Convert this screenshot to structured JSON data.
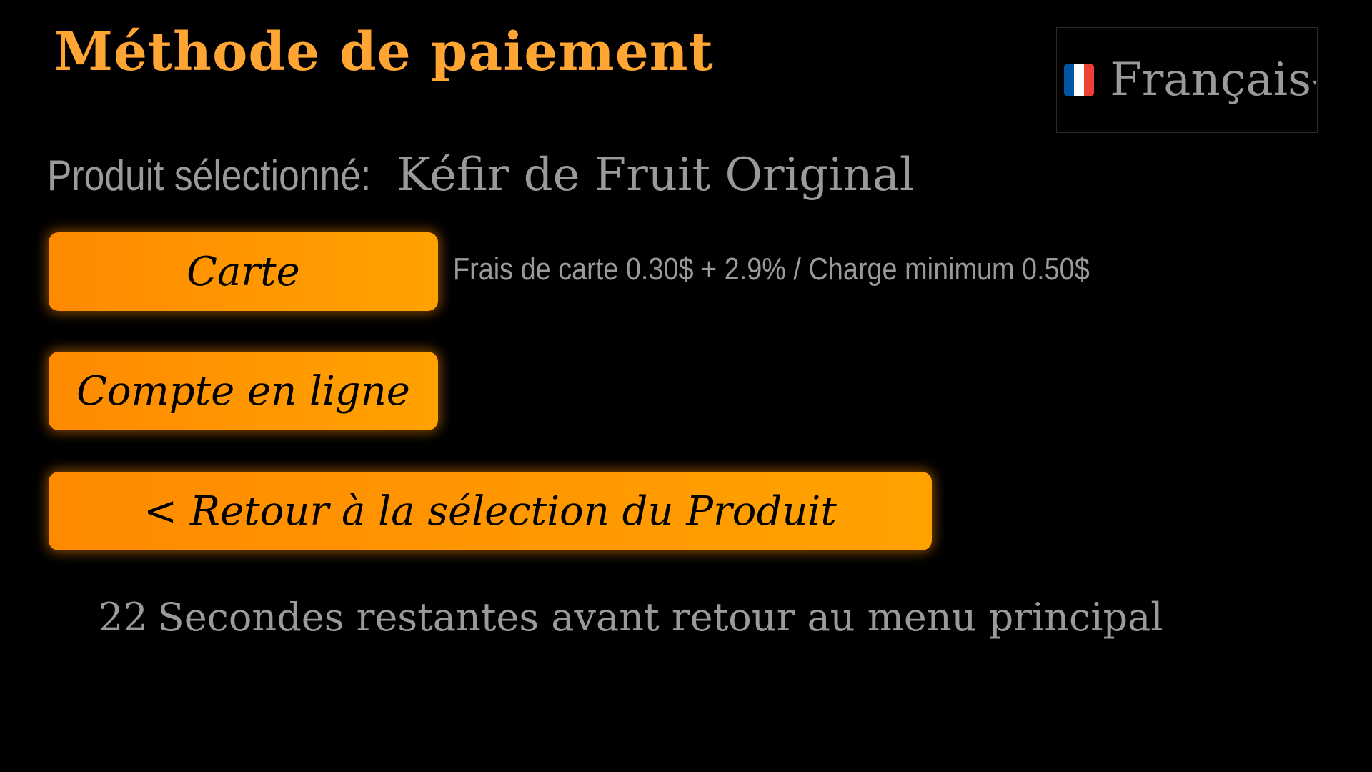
{
  "header": {
    "title": "Méthode de paiement"
  },
  "language": {
    "flag_icon": "french-flag-icon",
    "selected": "Français",
    "flag_colors": [
      "#0055a4",
      "#ffffff",
      "#ef4135"
    ]
  },
  "product": {
    "prefix": "Produit sélectionné:",
    "name": "Kéfir de Fruit Original"
  },
  "payment": {
    "card_label": "Carte",
    "card_fee_note": "Frais de carte 0.30$ + 2.9% / Charge minimum 0.50$",
    "account_label": "Compte en ligne",
    "back_label": "< Retour à la sélection du Produit"
  },
  "countdown": {
    "seconds": "22",
    "message": "Secondes restantes avant retour au menu principal"
  },
  "colors": {
    "background": "#000000",
    "title": "#ffa533",
    "button": "#ff9500",
    "muted_text": "#9a9a9a"
  }
}
